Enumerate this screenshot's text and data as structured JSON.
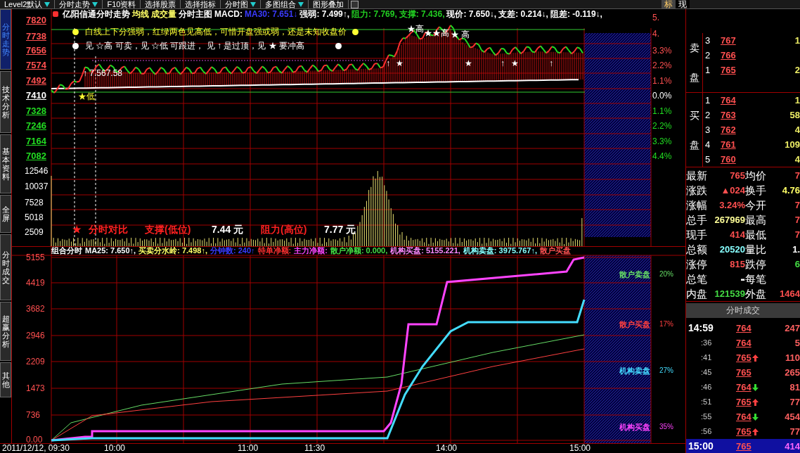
{
  "toolbar": {
    "items": [
      {
        "label": "Level2默认",
        "menu": true
      },
      {
        "label": "分时走势",
        "menu": true
      },
      {
        "label": "F10资料",
        "menu": false
      },
      {
        "label": "选择股票",
        "menu": false
      },
      {
        "label": "选择指标",
        "menu": false
      },
      {
        "label": "分时图",
        "menu": true
      },
      {
        "label": "多图组合",
        "menu": true
      },
      {
        "label": "图形叠加",
        "menu": false
      }
    ],
    "panel_tabs": [
      {
        "label": "标",
        "selected": true
      },
      {
        "label": "现",
        "selected": false
      }
    ]
  },
  "side_tabs": [
    {
      "label": "分时走势",
      "selected": true
    },
    {
      "label": "技术分析",
      "selected": false
    },
    {
      "label": "基本资料",
      "selected": false
    },
    {
      "label": "全屏",
      "selected": false
    },
    {
      "label": "分时成交",
      "selected": false
    },
    {
      "label": "超赢分析",
      "selected": false
    },
    {
      "label": "其他",
      "selected": false
    }
  ],
  "price_chart": {
    "header": [
      {
        "text": "亿阳信通分时走势",
        "color": "#ffffff"
      },
      {
        "text": "均线",
        "color": "#ffff66"
      },
      {
        "text": "成交量",
        "color": "#ffff66"
      },
      {
        "text": "分时主图",
        "color": "#ffffff"
      },
      {
        "text": "MACD:",
        "color": "#ffffff"
      },
      {
        "text": "MA30: 7.651↓",
        "color": "#3a3aff"
      },
      {
        "text": "强弱: 7.499↑,",
        "color": "#ffffff"
      },
      {
        "text": "阻力: 7.769,",
        "color": "#22cc22"
      },
      {
        "text": "支撑: 7.436,",
        "color": "#22cc22"
      },
      {
        "text": "现价: 7.650↓,",
        "color": "#ffffff"
      },
      {
        "text": "支差: 0.214↓,",
        "color": "#ffffff"
      },
      {
        "text": "阻差: -0.119↓,",
        "color": "#ffffff"
      }
    ],
    "price_labels": [
      {
        "text": "7820",
        "color": "#ff5050"
      },
      {
        "text": "7738",
        "color": "#ff5050"
      },
      {
        "text": "7656",
        "color": "#ff5050"
      },
      {
        "text": "7574",
        "color": "#ff5050"
      },
      {
        "text": "7492",
        "color": "#ff5050"
      },
      {
        "text": "7410",
        "color": "#ffffff"
      },
      {
        "text": "7328",
        "color": "#22dd22"
      },
      {
        "text": "7246",
        "color": "#22dd22"
      },
      {
        "text": "7164",
        "color": "#22dd22"
      },
      {
        "text": "7082",
        "color": "#22dd22"
      }
    ],
    "percent_labels": [
      {
        "text": "5.",
        "color": "#ff5050"
      },
      {
        "text": "4.",
        "color": "#ff5050"
      },
      {
        "text": "3.3%",
        "color": "#ff5050"
      },
      {
        "text": "2.2%",
        "color": "#ff5050"
      },
      {
        "text": "1.1%",
        "color": "#ff5050"
      },
      {
        "text": "0.0%",
        "color": "#ffffff"
      },
      {
        "text": "1.1%",
        "color": "#22dd22"
      },
      {
        "text": "2.2%",
        "color": "#22dd22"
      },
      {
        "text": "3.3%",
        "color": "#22dd22"
      },
      {
        "text": "4.4%",
        "color": "#22dd22"
      }
    ],
    "notes": [
      {
        "text": "白线上下分强弱，红绿两色见高低，可惜开盘强或弱，还是未知收盘价",
        "color": "#ffff33"
      },
      {
        "text": "见 ☆高 可卖，见 ☆低 可跟进， 见 ↑ 是过顶，见 ★ 要冲高",
        "color": "#ffffff"
      }
    ],
    "price_marks": [
      {
        "text": "↑ 7.567.58",
        "kind": "value"
      },
      {
        "text": "★低",
        "kind": "low"
      },
      {
        "text": "★高",
        "kind": "high"
      },
      {
        "text": "★★高",
        "kind": "high"
      },
      {
        "text": "★ 高",
        "kind": "high"
      },
      {
        "text": "↑",
        "kind": "arrow"
      },
      {
        "text": "★",
        "kind": "star"
      },
      {
        "text": "★",
        "kind": "star"
      },
      {
        "text": "↑",
        "kind": "arrow"
      },
      {
        "text": "★",
        "kind": "star"
      },
      {
        "text": "↑",
        "kind": "arrow"
      }
    ],
    "volume_labels": [
      "12546",
      "10037",
      "7528",
      "5018",
      "2509"
    ],
    "volume_legend": [
      {
        "text": "★",
        "color": "#ff2020"
      },
      {
        "text": "分时对比",
        "color": "#ff2020"
      },
      {
        "text": "支撑(低位)",
        "color": "#ff2020"
      },
      {
        "text": "7.44 元",
        "color": "#ffffff"
      },
      {
        "text": "阻力(高位)",
        "color": "#ff2020"
      },
      {
        "text": "7.77 元",
        "color": "#ffffff"
      }
    ]
  },
  "flow_chart": {
    "header": [
      {
        "text": "组合分时",
        "color": "#ffffff"
      },
      {
        "text": "MA25: 7.650↑,",
        "color": "#ffffff"
      },
      {
        "text": "买卖分水岭: 7.498↑,",
        "color": "#ffff66"
      },
      {
        "text": "分钟数: 240↑",
        "color": "#3a3aff"
      },
      {
        "text": "特单净额:",
        "color": "#ff3030"
      },
      {
        "text": "主力净额:",
        "color": "#ff44ff"
      },
      {
        "text": "散户净额: 0.000,",
        "color": "#44dd44"
      },
      {
        "text": "机构买盘: 5155.221,",
        "color": "#ff88ff"
      },
      {
        "text": "机构卖盘: 3975.767↑,",
        "color": "#88ffff"
      },
      {
        "text": "散户买盘",
        "color": "#ff5050"
      }
    ],
    "axis_labels": [
      "5155",
      "4419",
      "3682",
      "2946",
      "2209",
      "1473",
      "736",
      "0.00"
    ],
    "legend": [
      {
        "label": "散户卖盘",
        "percent": "20%",
        "color": "#66dd66"
      },
      {
        "label": "散户买盘",
        "percent": "17%",
        "color": "#ff4040"
      },
      {
        "label": "机构卖盘",
        "percent": "27%",
        "color": "#44ddff"
      },
      {
        "label": "机构买盘",
        "percent": "35%",
        "color": "#ff44ff"
      }
    ]
  },
  "time_axis": [
    "2011/12/12, 09:30",
    "10:00",
    "11:00",
    "11:30",
    "14:00",
    "15:00"
  ],
  "order_book": {
    "sell": {
      "label": "卖盘",
      "rows": [
        {
          "rank": "3",
          "price": "767",
          "volume": "1"
        },
        {
          "rank": "2",
          "price": "766"
        },
        {
          "rank": "1",
          "price": "765",
          "volume": "2"
        }
      ]
    },
    "buy": {
      "label": "买盘",
      "rows": [
        {
          "rank": "1",
          "price": "764",
          "volume": "1"
        },
        {
          "rank": "2",
          "price": "763",
          "volume": "58"
        },
        {
          "rank": "3",
          "price": "762",
          "volume": "4"
        },
        {
          "rank": "4",
          "price": "761",
          "volume": "109"
        },
        {
          "rank": "5",
          "price": "760",
          "volume": "4"
        }
      ]
    }
  },
  "quote": [
    {
      "left": {
        "label": "最新",
        "value": "765",
        "color": "#ff5050"
      },
      "right": {
        "label": "均价",
        "value": "7",
        "color": "#ff5050"
      }
    },
    {
      "left": {
        "label": "涨跌",
        "value": "▲024",
        "color": "#ff5050"
      },
      "right": {
        "label": "换手",
        "value": "4.76",
        "color": "#ffff66"
      }
    },
    {
      "left": {
        "label": "涨幅",
        "value": "3.24%",
        "color": "#ff5050"
      },
      "right": {
        "label": "今开",
        "value": "7",
        "color": "#ff5050"
      }
    },
    {
      "left": {
        "label": "总手",
        "value": "267969",
        "color": "#ffff99"
      },
      "right": {
        "label": "最高",
        "value": "7",
        "color": "#ff5050"
      }
    },
    {
      "left": {
        "label": "现手",
        "value": "414",
        "color": "#ff5050"
      },
      "right": {
        "label": "最低",
        "value": "7",
        "color": "#ff5050"
      }
    },
    {
      "left": {
        "label": "总额",
        "value": "20520",
        "color": "#88ffff"
      },
      "right": {
        "label": "量比",
        "value": "1.",
        "color": "#ffffff"
      }
    },
    {
      "left": {
        "label": "涨停",
        "value": "815",
        "color": "#ff5050"
      },
      "right": {
        "label": "跌停",
        "value": "6",
        "color": "#44dd44"
      }
    },
    {
      "left": {
        "label": "总笔",
        "value": "-",
        "color": "#ffffff"
      },
      "right": {
        "label": "每笔"
      }
    },
    {
      "left": {
        "label": "内盘",
        "value": "121539",
        "color": "#44dd44"
      },
      "right": {
        "label": "外盘",
        "value": "1464",
        "color": "#ff5050"
      }
    }
  ],
  "trades": {
    "title": "分时成交",
    "rows": [
      {
        "kind": "flat",
        "time": "14:59",
        "price": "764",
        "volume": "247",
        "selected": false
      },
      {
        "kind": "flat",
        "time": ":36",
        "price": "764",
        "volume": "5",
        "selected": false
      },
      {
        "kind": "up",
        "time": ":41",
        "price": "765",
        "volume": "110",
        "selected": false
      },
      {
        "kind": "flat",
        "time": ":45",
        "price": "765",
        "volume": "265",
        "selected": false
      },
      {
        "kind": "down",
        "time": ":46",
        "price": "764",
        "volume": "81",
        "selected": false
      },
      {
        "kind": "up",
        "time": ":51",
        "price": "765",
        "volume": "77",
        "selected": false
      },
      {
        "kind": "down",
        "time": ":55",
        "price": "764",
        "volume": "454",
        "selected": false
      },
      {
        "kind": "up",
        "time": ":56",
        "price": "765",
        "volume": "77",
        "selected": false
      },
      {
        "kind": "flat",
        "time": "15:00",
        "price": "765",
        "volume": "414",
        "selected": true
      }
    ]
  }
}
